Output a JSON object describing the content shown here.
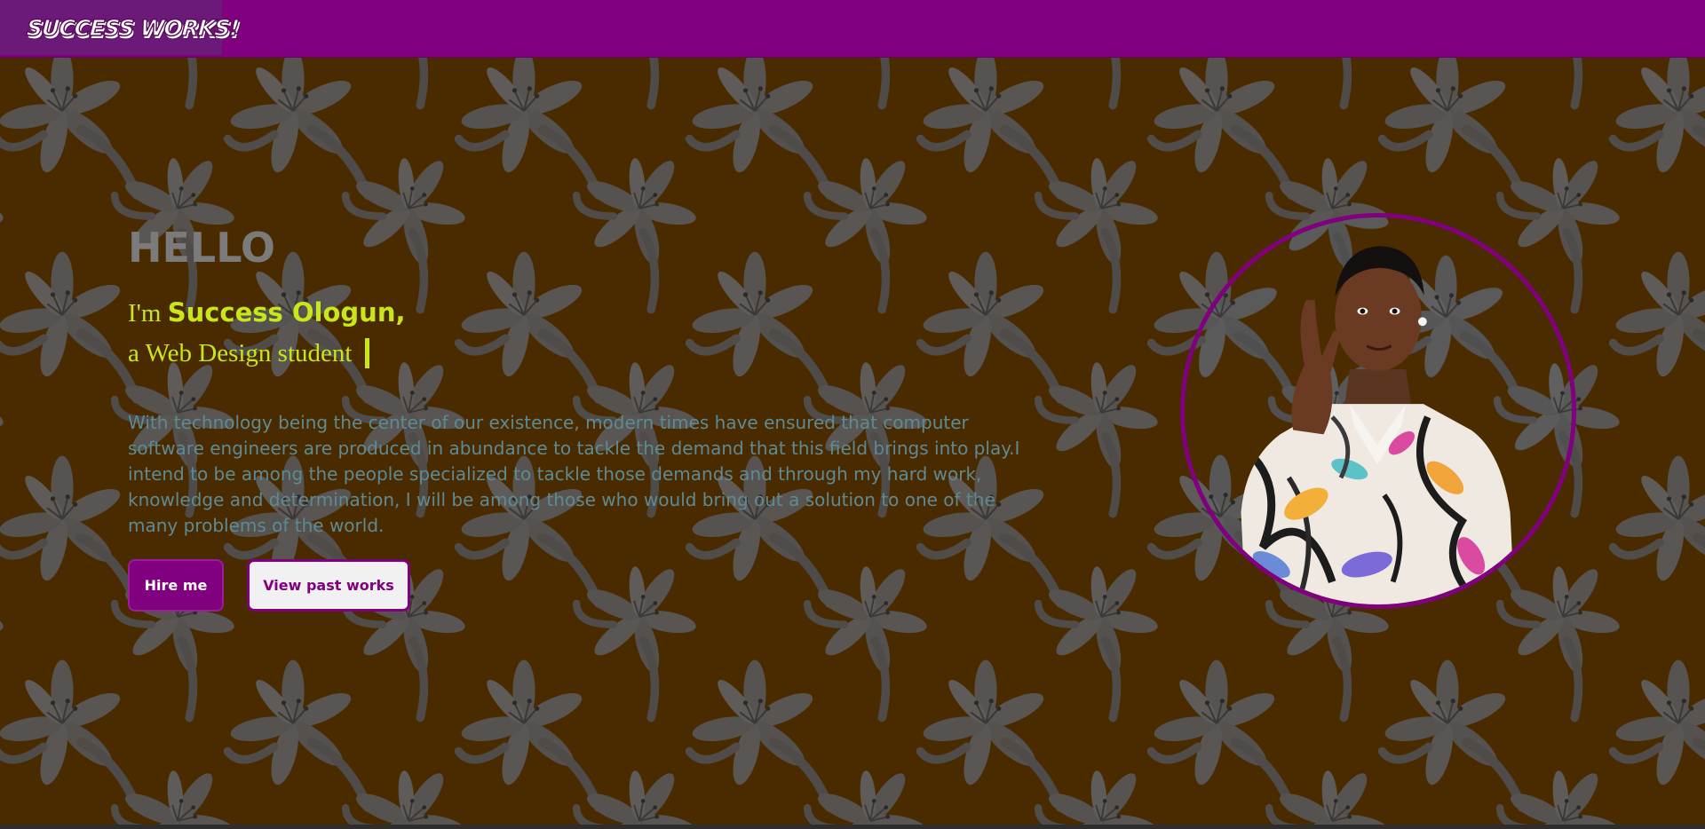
{
  "brand": {
    "logo_text": "SUCCESS WORKS!"
  },
  "hero": {
    "greeting": "HELLO",
    "intro_prefix": "I'm ",
    "name": "Success Ologun,",
    "role": "a Web Design student",
    "bio": "With technology being the center of our existence, modern times have ensured that computer software engineers are produced in abundance to tackle the demand that this field brings into play.I intend to be among the people specialized to tackle those demands and through my hard work, knowledge and determination, I will be among those who would bring out a solution to one of the many problems of the world.",
    "hire_button": "Hire me",
    "works_button": "View past works"
  },
  "colors": {
    "nav": "#800080",
    "background": "#4a2c00",
    "accent": "#c8e619",
    "bio_text": "#5e8a93",
    "greeting": "#7b7b7b"
  },
  "icons": {
    "background_pattern": "lily-flower-pattern",
    "portrait": "profile-photo"
  }
}
